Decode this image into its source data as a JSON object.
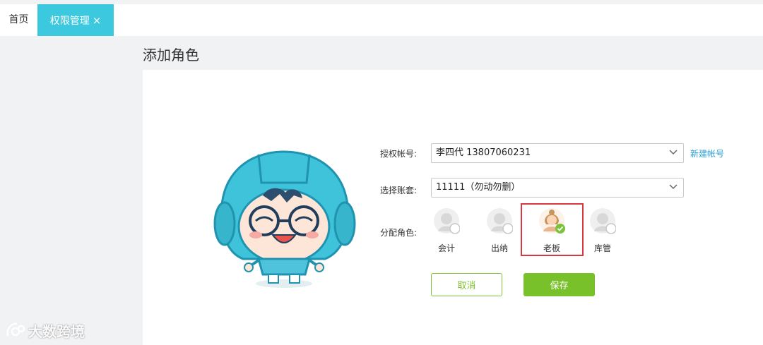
{
  "tabs": {
    "home_label": "首页",
    "active_label": "权限管理",
    "close_glyph": "×"
  },
  "page_title": "添加角色",
  "form": {
    "account_label": "授权帐号:",
    "account_value": "李四代 13807060231",
    "new_account_link": "新建帐号",
    "book_label": "选择账套:",
    "book_value": "11111（勿动勿删）",
    "role_label": "分配角色:",
    "roles": [
      {
        "name": "会计",
        "selected": false
      },
      {
        "name": "出纳",
        "selected": false
      },
      {
        "name": "老板",
        "selected": true
      },
      {
        "name": "库管",
        "selected": false
      }
    ]
  },
  "buttons": {
    "cancel_label": "取消",
    "save_label": "保存"
  },
  "watermark": "大数跨境",
  "colors": {
    "tab_active": "#3cc8de",
    "accent_green": "#79c12b",
    "link_blue": "#2a9fd6",
    "highlight_red": "#d9393e"
  },
  "icons": {
    "caret": "chevron-down-icon",
    "check": "check-circle-icon",
    "mascot": "mascot-illustration"
  }
}
